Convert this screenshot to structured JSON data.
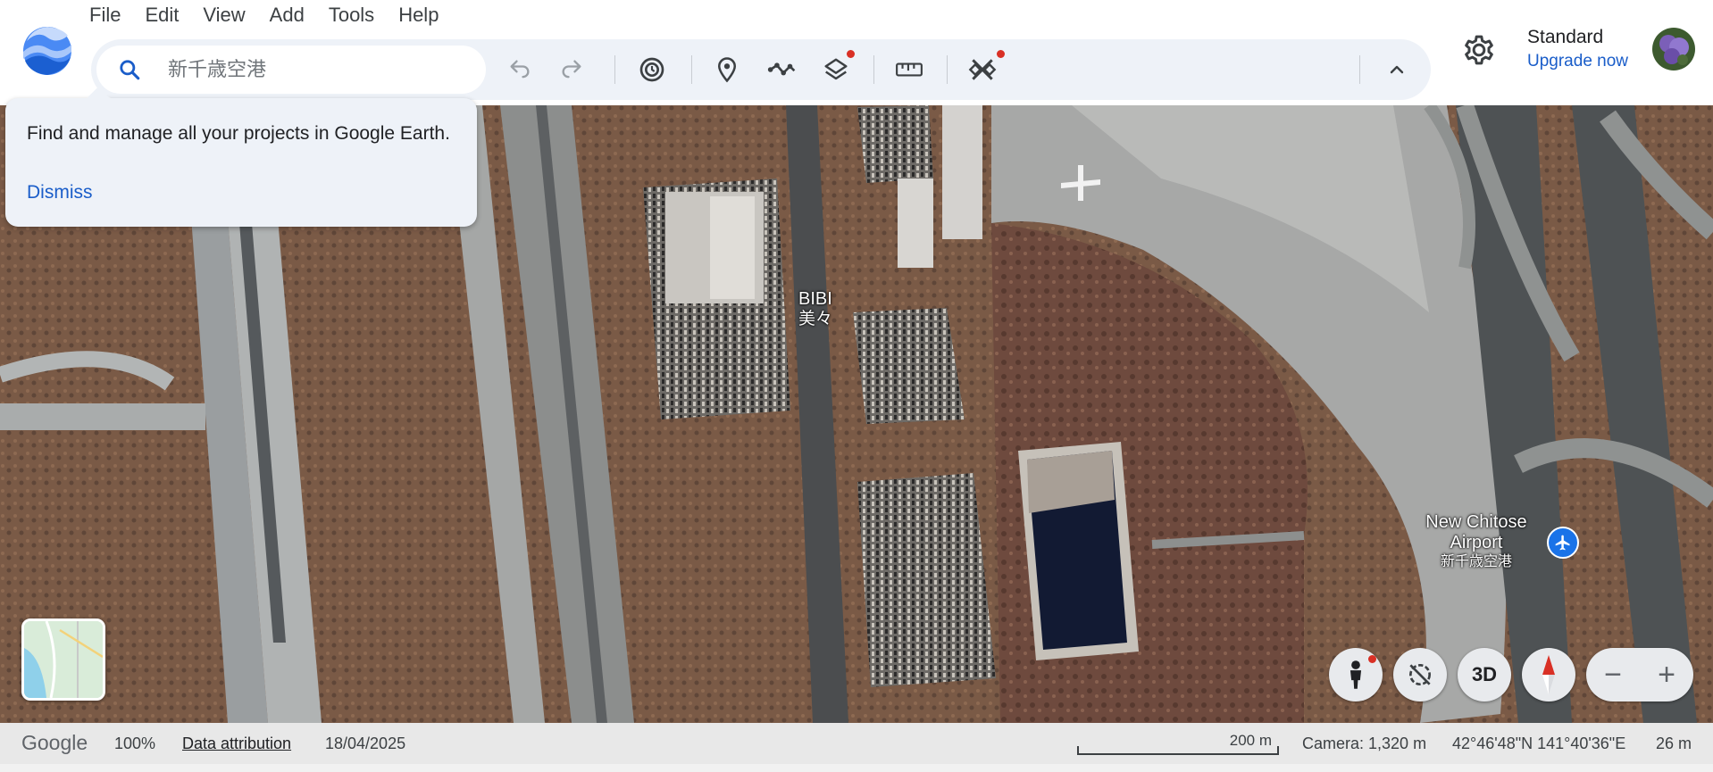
{
  "menu": [
    "File",
    "Edit",
    "View",
    "Add",
    "Tools",
    "Help"
  ],
  "search": {
    "placeholder": "新千歳空港"
  },
  "toolbar": {
    "icons": [
      "undo-icon",
      "redo-icon",
      "history-icon",
      "placemark-icon",
      "path-icon",
      "layers-icon",
      "ruler-icon",
      "satellite-icon",
      "chevron-up-icon"
    ]
  },
  "account": {
    "plan": "Standard",
    "upgrade_label": "Upgrade now"
  },
  "popup": {
    "text": "Find and manage all your projects in Google Earth.",
    "dismiss_label": "Dismiss"
  },
  "map_labels": {
    "airport": {
      "name_line1": "New Chitose",
      "name_line2": "Airport",
      "name_local": "新千歳空港"
    },
    "bibi": {
      "name": "BIBI",
      "name_local": "美々"
    }
  },
  "controls": {
    "three_d_label": "3D",
    "zoom_out": "−",
    "zoom_in": "+"
  },
  "status": {
    "brand": "Google",
    "zoom": "100%",
    "data_attribution": "Data attribution",
    "date": "18/04/2025",
    "scale": "200 m",
    "camera": "Camera: 1,320 m",
    "coordinates": "42°46'48\"N 141°40'36\"E",
    "elevation": "26 m"
  },
  "colors": {
    "accent_blue": "#1a5dc9",
    "notification_red": "#d93025",
    "toolbar_bg": "#eef2f8"
  }
}
